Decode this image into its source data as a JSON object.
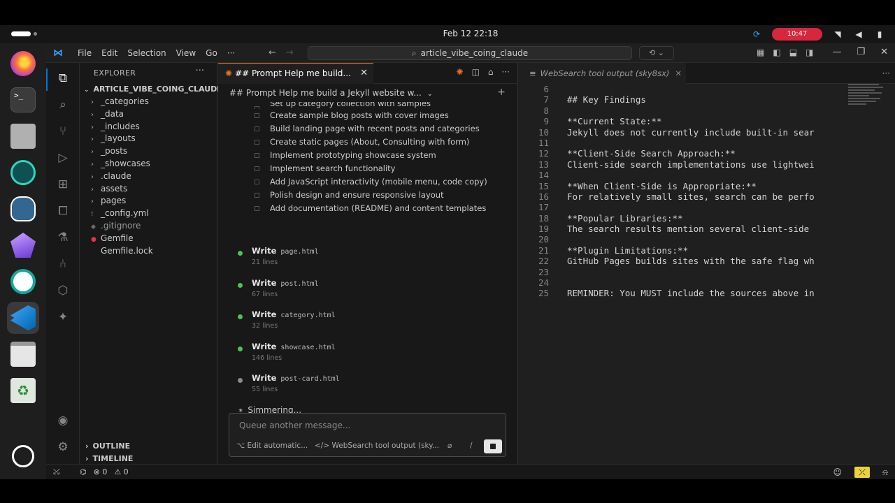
{
  "system": {
    "clock": "Feb 12  22:18",
    "rec_badge": "10:47"
  },
  "vscode": {
    "menu": [
      "File",
      "Edit",
      "Selection",
      "View",
      "Go",
      "···"
    ],
    "search_text": "article_vibe_coing_claude"
  },
  "sidebar": {
    "header": "EXPLORER",
    "more": "···",
    "root": "ARTICLE_VIBE_COING_CLAUDE",
    "items": [
      {
        "label": "_categories",
        "type": "folder"
      },
      {
        "label": "_data",
        "type": "folder"
      },
      {
        "label": "_includes",
        "type": "folder"
      },
      {
        "label": "_layouts",
        "type": "folder"
      },
      {
        "label": "_posts",
        "type": "folder"
      },
      {
        "label": "_showcases",
        "type": "folder"
      },
      {
        "label": ".claude",
        "type": "folder"
      },
      {
        "label": "assets",
        "type": "folder"
      },
      {
        "label": "pages",
        "type": "folder"
      },
      {
        "label": "_config.yml",
        "type": "file"
      },
      {
        "label": ".gitignore",
        "type": "file"
      },
      {
        "label": "Gemfile",
        "type": "file"
      },
      {
        "label": "Gemfile.lock",
        "type": "file"
      }
    ],
    "outline": "OUTLINE",
    "timeline": "TIMELINE"
  },
  "chat": {
    "tab_title": "## Prompt Help me build...",
    "subheader": "## Prompt Help me build a Jekyll website w...",
    "todos": [
      "Set up category collection with samples",
      "Create sample blog posts with cover images",
      "Build landing page with recent posts and categories",
      "Create static pages (About, Consulting with form)",
      "Implement prototyping showcase system",
      "Implement search functionality",
      "Add JavaScript interactivity (mobile menu, code copy)",
      "Polish design and ensure responsive layout",
      "Add documentation (README) and content templates"
    ],
    "tools": [
      {
        "verb": "Write",
        "file": "page.html",
        "lines": "21 lines",
        "status": "done"
      },
      {
        "verb": "Write",
        "file": "post.html",
        "lines": "67 lines",
        "status": "done"
      },
      {
        "verb": "Write",
        "file": "category.html",
        "lines": "32 lines",
        "status": "done"
      },
      {
        "verb": "Write",
        "file": "showcase.html",
        "lines": "146 lines",
        "status": "done"
      },
      {
        "verb": "Write",
        "file": "post-card.html",
        "lines": "55 lines",
        "status": "pending"
      }
    ],
    "status": "Simmering...",
    "input_placeholder": "Queue another message...",
    "footer_edit": "Edit automatic...",
    "footer_context": "WebSearch tool output (sky...",
    "footer_slash": "/"
  },
  "editor": {
    "tab_title": "WebSearch tool output (sky8sx)",
    "lines": [
      {
        "n": "6",
        "t": ""
      },
      {
        "n": "7",
        "t": "## Key Findings"
      },
      {
        "n": "8",
        "t": ""
      },
      {
        "n": "9",
        "t": "**Current State:**"
      },
      {
        "n": "10",
        "t": "Jekyll does not currently include built-in sear"
      },
      {
        "n": "11",
        "t": ""
      },
      {
        "n": "12",
        "t": "**Client-Side Search Approach:**"
      },
      {
        "n": "13",
        "t": "Client-side search implementations use lightwei"
      },
      {
        "n": "14",
        "t": ""
      },
      {
        "n": "15",
        "t": "**When Client-Side is Appropriate:**"
      },
      {
        "n": "16",
        "t": "For relatively small sites, search can be perfo"
      },
      {
        "n": "17",
        "t": ""
      },
      {
        "n": "18",
        "t": "**Popular Libraries:**"
      },
      {
        "n": "19",
        "t": "The search results mention several client-side"
      },
      {
        "n": "20",
        "t": ""
      },
      {
        "n": "21",
        "t": "**Plugin Limitations:**"
      },
      {
        "n": "22",
        "t": "GitHub Pages builds sites with the safe flag wh"
      },
      {
        "n": "23",
        "t": ""
      },
      {
        "n": "24",
        "t": ""
      },
      {
        "n": "25",
        "t": "REMINDER: You MUST include the sources above in"
      }
    ]
  },
  "statusbar": {
    "errors": "⊗ 0",
    "warnings": "⚠ 0"
  }
}
